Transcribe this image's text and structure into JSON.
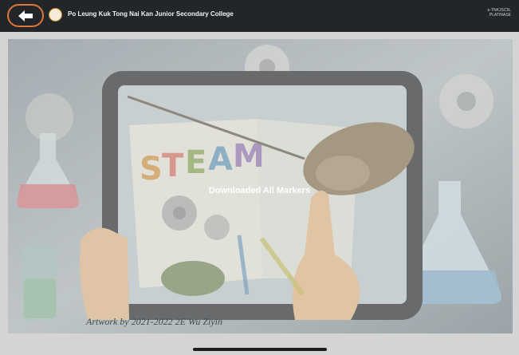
{
  "header": {
    "back_icon": "arrow-left-icon",
    "logo_icon": "school-crest-icon",
    "title": "Po Leung Kuk Tong Nai Kan Junior Secondary College",
    "account_line1": "e-TNKJSC5L",
    "account_line2": "PLATINASE"
  },
  "artwork": {
    "label": "STEAM",
    "credit": "Artwork by 2021-2022 2E Wu Ziyin"
  },
  "status": {
    "message": "Downloaded All Markers"
  },
  "colors": {
    "topbar": "#232629",
    "back_highlight": "#e0743a",
    "screen_bg": "#d4d4d4",
    "overlay_text": "#ffffff"
  }
}
